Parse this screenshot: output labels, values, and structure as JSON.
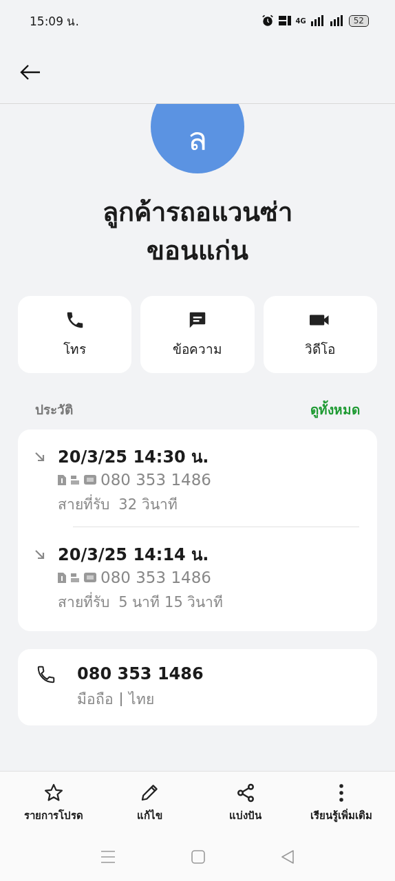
{
  "status_bar": {
    "time": "15:09 น.",
    "network": "4G",
    "battery": "52"
  },
  "contact": {
    "initial": "ล",
    "name": "ลูกค้ารถอแวนซ่า ขอนแก่น"
  },
  "actions": [
    {
      "kind": "call",
      "label": "โทร"
    },
    {
      "kind": "message",
      "label": "ข้อความ"
    },
    {
      "kind": "video",
      "label": "วิดีโอ"
    }
  ],
  "history": {
    "title": "ประวัติ",
    "view_all": "ดูทั้งหมด",
    "calls": [
      {
        "datetime": "20/3/25 14:30 น.",
        "number": "080 353 1486",
        "type": "สายที่รับ",
        "duration": "32 วินาที"
      },
      {
        "datetime": "20/3/25 14:14 น.",
        "number": "080 353 1486",
        "type": "สายที่รับ",
        "duration": "5 นาที 15 วินาที"
      }
    ]
  },
  "phone": {
    "number": "080 353 1486",
    "label": "มือถือ",
    "region": "ไทย"
  },
  "bottom_actions": [
    {
      "kind": "favorite",
      "label": "รายการโปรด"
    },
    {
      "kind": "edit",
      "label": "แก้ไข"
    },
    {
      "kind": "share",
      "label": "แบ่งปัน"
    },
    {
      "kind": "more",
      "label": "เรียนรู้เพิ่มเติม"
    }
  ]
}
